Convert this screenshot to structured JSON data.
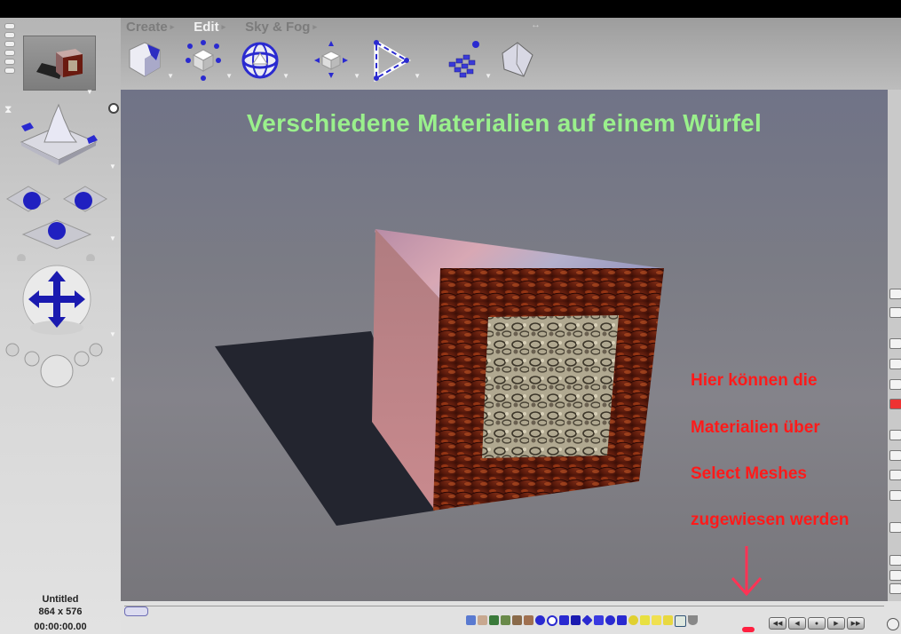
{
  "menus": [
    {
      "label": "Create",
      "active": false
    },
    {
      "label": "Edit",
      "active": true
    },
    {
      "label": "Sky & Fog",
      "active": false
    }
  ],
  "toolbar_icons": [
    "cube-primitive-icon",
    "move-object-icon",
    "rotate-object-icon",
    "scale-object-icon",
    "path-animation-icon",
    "terrain-grid-icon",
    "mesh-object-icon"
  ],
  "side_icons": [
    "terrain-preview-icon",
    "pan-camera-icon",
    "move-camera-trackball-icon",
    "lights-icon"
  ],
  "viewport": {
    "title": "Verschiedene Materialien auf einem Würfel",
    "note_lines": [
      "Hier können die",
      "Materialien über",
      "Select Meshes",
      "zugewiesen werden"
    ]
  },
  "document": {
    "name": "Untitled",
    "size": "864 x 576",
    "time": "00:00:00.00"
  },
  "colors": {
    "title": "#9af08c",
    "note": "#ff1a1a",
    "accent": "#2a2ad0"
  }
}
